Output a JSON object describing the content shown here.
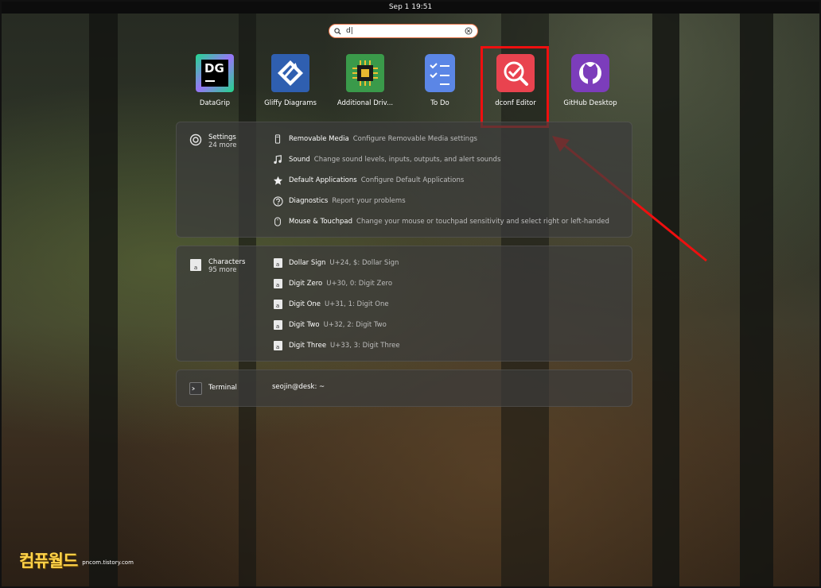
{
  "topbar": {
    "clock": "Sep 1  19:51"
  },
  "search": {
    "value": "d|",
    "icon": "search-icon"
  },
  "apps": [
    {
      "label": "DataGrip",
      "icon": "datagrip-icon"
    },
    {
      "label": "Gliffy Diagrams",
      "icon": "gliffy-icon"
    },
    {
      "label": "Additional Driv...",
      "icon": "chip-icon"
    },
    {
      "label": "To Do",
      "icon": "todo-icon"
    },
    {
      "label": "dconf Editor",
      "icon": "dconf-icon"
    },
    {
      "label": "GitHub Desktop",
      "icon": "github-icon"
    }
  ],
  "datagrip_logo": "DG",
  "settings": {
    "title": "Settings",
    "more": "24 more",
    "rows": [
      {
        "title": "Removable Media",
        "desc": "Configure Removable Media settings"
      },
      {
        "title": "Sound",
        "desc": "Change sound levels, inputs, outputs, and alert sounds"
      },
      {
        "title": "Default Applications",
        "desc": "Configure Default Applications"
      },
      {
        "title": "Diagnostics",
        "desc": "Report your problems"
      },
      {
        "title": "Mouse & Touchpad",
        "desc": "Change your mouse or touchpad sensitivity and select right or left-handed"
      }
    ]
  },
  "characters": {
    "title": "Characters",
    "more": "95 more",
    "glyph": "a",
    "rows": [
      {
        "title": "Dollar Sign",
        "desc": "U+24, $: Dollar Sign"
      },
      {
        "title": "Digit Zero",
        "desc": "U+30, 0: Digit Zero"
      },
      {
        "title": "Digit One",
        "desc": "U+31, 1: Digit One"
      },
      {
        "title": "Digit Two",
        "desc": "U+32, 2: Digit Two"
      },
      {
        "title": "Digit Three",
        "desc": "U+33, 3: Digit Three"
      }
    ]
  },
  "terminal": {
    "title": "Terminal",
    "result": "seojin@desk: ~"
  },
  "watermark": {
    "brand": "컴퓨월드",
    "url": "pncom.tistory.com"
  },
  "colors": {
    "highlight": "#ef0f0f",
    "search_border": "#e8764a"
  }
}
